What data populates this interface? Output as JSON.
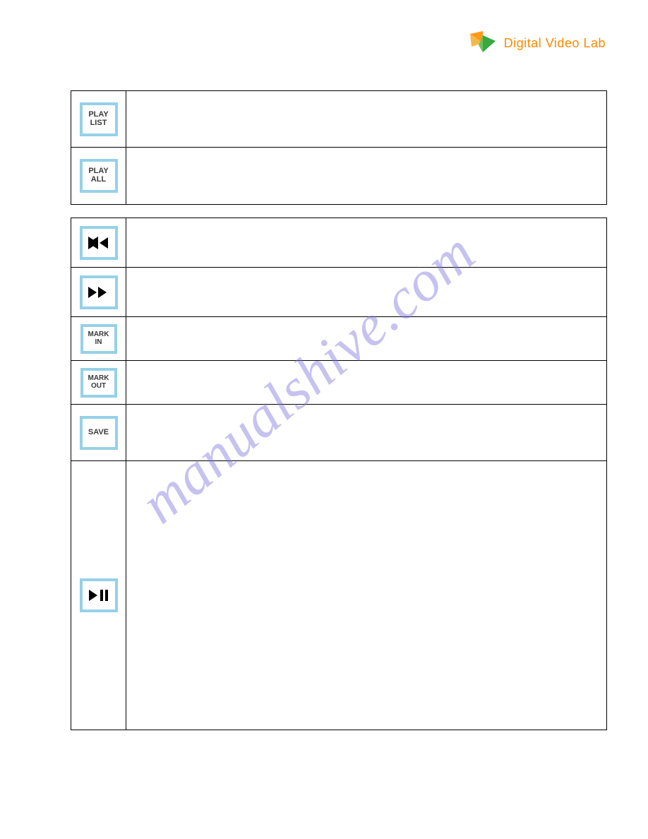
{
  "brand": {
    "name": "Digital Video Lab"
  },
  "watermark": "manualshive.com",
  "buttons": {
    "play_list": {
      "line1": "PLAY",
      "line2": "LIST"
    },
    "play_all": {
      "line1": "PLAY",
      "line2": "ALL"
    },
    "rewind": {
      "icon": "rewind"
    },
    "forward": {
      "icon": "fast-forward"
    },
    "mark_in": {
      "line1": "MARK",
      "line2": "IN"
    },
    "mark_out": {
      "line1": "MARK",
      "line2": "OUT"
    },
    "save": {
      "line1": "SAVE"
    },
    "play_pause": {
      "icon": "play-pause"
    }
  }
}
